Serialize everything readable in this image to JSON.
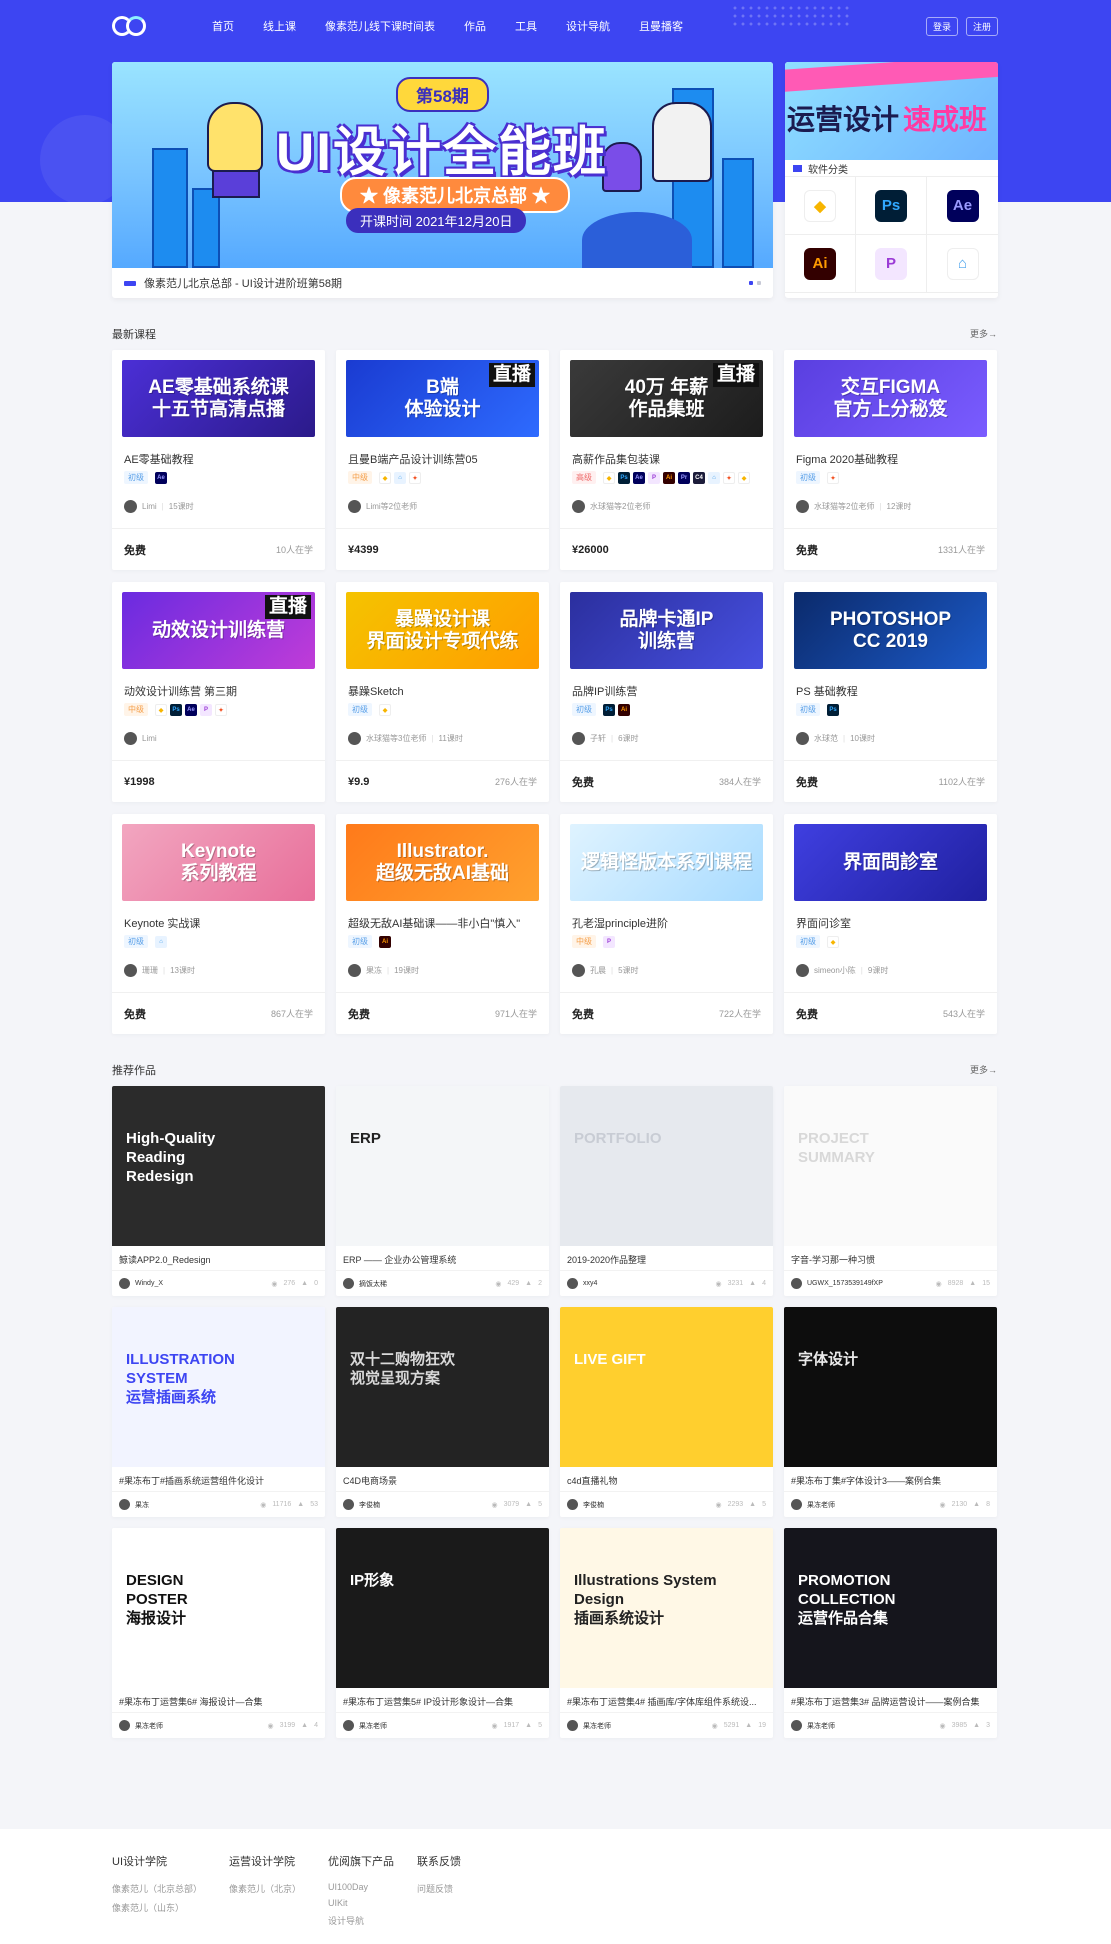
{
  "nav": {
    "items": [
      "首页",
      "线上课",
      "像素范儿线下课时间表",
      "作品",
      "工具",
      "设计导航",
      "且曼播客"
    ],
    "login": "登录",
    "register": "注册"
  },
  "banner": {
    "issue": "第58期",
    "title": "UI设计全能班",
    "subtitle": "★ 像素范儿北京总部 ★",
    "date": "开课时间 2021年12月20日",
    "caption": "像素范儿北京总部 - UI设计进阶班第58期"
  },
  "side": {
    "banner_text_1": "运营设计",
    "banner_text_2": "速成班",
    "category_title": "软件分类",
    "apps": [
      {
        "name": "sketch-icon",
        "label": "◆",
        "bg": "#fff",
        "fg": "#f7b500"
      },
      {
        "name": "photoshop-icon",
        "label": "Ps",
        "bg": "#001e36",
        "fg": "#31a8ff"
      },
      {
        "name": "after-effects-icon",
        "label": "Ae",
        "bg": "#00005b",
        "fg": "#9999ff"
      },
      {
        "name": "illustrator-icon",
        "label": "Ai",
        "bg": "#330000",
        "fg": "#ff9a00"
      },
      {
        "name": "principle-icon",
        "label": "P",
        "bg": "#f3e6ff",
        "fg": "#9b3bd6"
      },
      {
        "name": "keynote-icon",
        "label": "⌂",
        "bg": "#fff",
        "fg": "#4aa3ec"
      }
    ]
  },
  "courses_section": {
    "title": "最新课程",
    "more": "更多→"
  },
  "courses": [
    {
      "thumb": "AE零基础系统课\n十五节高清点播",
      "bg": "linear-gradient(135deg,#4b2fd6,#2b1a8a)",
      "live": "",
      "title": "AE零基础教程",
      "level": "初级",
      "lv": "c",
      "icons": [
        "Ae"
      ],
      "teacher": "Limi",
      "lessons": "15课时",
      "price": "免费",
      "learners": "10人在学"
    },
    {
      "thumb": "B端\n体验设计",
      "bg": "linear-gradient(135deg,#1a3bd1,#2e6bff)",
      "live": "直播",
      "title": "且曼B端产品设计训练营05",
      "level": "中级",
      "lv": "m",
      "icons": [
        "Sk",
        "Kn",
        "Fg"
      ],
      "teacher": "Limi等2位老师",
      "lessons": "",
      "price": "¥4399",
      "learners": ""
    },
    {
      "thumb": "40万 年薪\n作品集班",
      "bg": "linear-gradient(135deg,#3a3a3a,#1c1c1c)",
      "live": "直播",
      "title": "高薪作品集包装课",
      "level": "高级",
      "lv": "g",
      "icons": [
        "Sk",
        "Ps",
        "Ae",
        "P",
        "Ai",
        "Pr",
        "C4",
        "Kn",
        "Fg",
        "Sk"
      ],
      "teacher": "水球猫等2位老师",
      "lessons": "",
      "price": "¥26000",
      "learners": ""
    },
    {
      "thumb": "交互FIGMA\n官方上分秘笈",
      "bg": "linear-gradient(135deg,#5a3fe0,#7a5cff)",
      "live": "",
      "title": "Figma 2020基础教程",
      "level": "初级",
      "lv": "c",
      "icons": [
        "Fg"
      ],
      "teacher": "水球猫等2位老师",
      "lessons": "12课时",
      "price": "免费",
      "learners": "1331人在学"
    },
    {
      "thumb": "动效设计训练营",
      "bg": "linear-gradient(135deg,#6a2be0,#c03cd8)",
      "live": "直播",
      "title": "动效设计训练营 第三期",
      "level": "中级",
      "lv": "m",
      "icons": [
        "Sk",
        "Ps",
        "Ae",
        "P",
        "Fg"
      ],
      "teacher": "Limi",
      "lessons": "",
      "price": "¥1998",
      "learners": ""
    },
    {
      "thumb": "暴躁设计课\n界面设计专项代练",
      "bg": "linear-gradient(135deg,#f5c300,#ff9d00)",
      "live": "",
      "title": "暴躁Sketch",
      "level": "初级",
      "lv": "c",
      "icons": [
        "Sk"
      ],
      "teacher": "水球猫等3位老师",
      "lessons": "11课时",
      "price": "¥9.9",
      "learners": "276人在学"
    },
    {
      "thumb": "品牌卡通IP\n训练营",
      "bg": "linear-gradient(135deg,#2b2f9e,#4750e0)",
      "live": "",
      "title": "品牌IP训练营",
      "level": "初级",
      "lv": "c",
      "icons": [
        "Ps",
        "Ai"
      ],
      "teacher": "子轩",
      "lessons": "6课时",
      "price": "免费",
      "learners": "384人在学"
    },
    {
      "thumb": "PHOTOSHOP\nCC 2019",
      "bg": "linear-gradient(135deg,#0b2a6b,#1c5ac8)",
      "live": "",
      "title": "PS 基础教程",
      "level": "初级",
      "lv": "c",
      "icons": [
        "Ps"
      ],
      "teacher": "水球范",
      "lessons": "10课时",
      "price": "免费",
      "learners": "1102人在学"
    },
    {
      "thumb": "Keynote\n系列教程",
      "bg": "linear-gradient(135deg,#f2a6c0,#e86f9a)",
      "live": "",
      "title": "Keynote 实战课",
      "level": "初级",
      "lv": "c",
      "icons": [
        "Kn"
      ],
      "teacher": "珊珊",
      "lessons": "13课时",
      "price": "免费",
      "learners": "867人在学"
    },
    {
      "thumb": "Illustrator.\n超级无敌AI基础",
      "bg": "linear-gradient(135deg,#ff7a1a,#ffa12e)",
      "live": "",
      "title": "超级无敌AI基础课——非小白\"慎入\"",
      "level": "初级",
      "lv": "c",
      "icons": [
        "Ai"
      ],
      "teacher": "果冻",
      "lessons": "19课时",
      "price": "免费",
      "learners": "971人在学"
    },
    {
      "thumb": "逻辑怪版本系列课程",
      "bg": "linear-gradient(135deg,#dff3ff,#a8dbff)",
      "live": "",
      "title": "孔老湿principle进阶",
      "level": "中级",
      "lv": "m",
      "icons": [
        "P"
      ],
      "teacher": "孔晨",
      "lessons": "5课时",
      "price": "免费",
      "learners": "722人在学"
    },
    {
      "thumb": "界面問診室",
      "bg": "linear-gradient(135deg,#3f3fe0,#2020a0)",
      "live": "",
      "title": "界面问诊室",
      "level": "初级",
      "lv": "c",
      "icons": [
        "Sk"
      ],
      "teacher": "simeon小陈",
      "lessons": "9课时",
      "price": "免费",
      "learners": "543人在学"
    }
  ],
  "works_section": {
    "title": "推荐作品",
    "more": "更多→"
  },
  "works": [
    {
      "img": "High-Quality\nReading\nRedesign",
      "bg": "#2b2b2b",
      "fg": "#fff",
      "title": "鲸读APP2.0_Redesign",
      "author": "Windy_X",
      "views": "276",
      "likes": "0"
    },
    {
      "img": "ERP",
      "bg": "#f4f6f8",
      "fg": "#222",
      "title": "ERP —— 企业办公管理系统",
      "author": "摘饭太稀",
      "views": "429",
      "likes": "2"
    },
    {
      "img": "PORTFOLIO",
      "bg": "#e6e9ee",
      "fg": "#c8ccd4",
      "title": "2019-2020作品整理",
      "author": "xxy4",
      "views": "3231",
      "likes": "4"
    },
    {
      "img": "PROJECT\nSUMMARY",
      "bg": "#fafafa",
      "fg": "#d8d8d8",
      "title": "字音-学习那一种习惯",
      "author": "UGWX_1573539149fXP",
      "views": "8928",
      "likes": "15"
    },
    {
      "img": "ILLUSTRATION\nSYSTEM\n运营插画系统",
      "bg": "#f2f4ff",
      "fg": "#3d45f2",
      "title": "#果冻布丁#插画系统运营组件化设计",
      "author": "果冻",
      "views": "11716",
      "likes": "53"
    },
    {
      "img": "双十二购物狂欢\n视觉呈现方案",
      "bg": "#232323",
      "fg": "#d9d9d9",
      "title": "C4D电商场景",
      "author": "李俊楠",
      "views": "3079",
      "likes": "5"
    },
    {
      "img": "LIVE GIFT",
      "bg": "#ffcf2e",
      "fg": "#fff",
      "title": "c4d直播礼物",
      "author": "李俊楠",
      "views": "2293",
      "likes": "5"
    },
    {
      "img": "字体设计",
      "bg": "#0d0d0d",
      "fg": "#eaeaea",
      "title": "#果冻布丁集#字体设计3——案例合集",
      "author": "果冻老师",
      "views": "2130",
      "likes": "8"
    },
    {
      "img": "DESIGN\nPOSTER\n海报设计",
      "bg": "#ffffff",
      "fg": "#111",
      "title": "#果冻布丁运营集6# 海报设计—合集",
      "author": "果冻老师",
      "views": "3199",
      "likes": "4"
    },
    {
      "img": "IP形象",
      "bg": "#1a1a1a",
      "fg": "#fff",
      "title": "#果冻布丁运营集5# IP设计形象设计—合集",
      "author": "果冻老师",
      "views": "1917",
      "likes": "5"
    },
    {
      "img": "Illustrations System Design\n插画系统设计",
      "bg": "#fff8e6",
      "fg": "#222",
      "title": "#果冻布丁运营集4# 插画库/字体库组件系统设...",
      "author": "果冻老师",
      "views": "5291",
      "likes": "19"
    },
    {
      "img": "PROMOTION COLLECTION\n运营作品合集",
      "bg": "#15151c",
      "fg": "#fff",
      "title": "#果冻布丁运营集3# 品牌运营设计——案例合集",
      "author": "果冻老师",
      "views": "3985",
      "likes": "3"
    }
  ],
  "footer": {
    "cols": [
      {
        "title": "UI设计学院",
        "links": [
          "像素范儿（北京总部）",
          "像素范儿（山东）"
        ]
      },
      {
        "title": "运营设计学院",
        "links": [
          "像素范儿（北京）"
        ]
      },
      {
        "title": "优阅旗下产品",
        "links": [
          "UI100Day",
          "UIKit",
          "设计导航"
        ]
      },
      {
        "title": "联系反馈",
        "links": [
          "问题反馈"
        ]
      }
    ]
  }
}
